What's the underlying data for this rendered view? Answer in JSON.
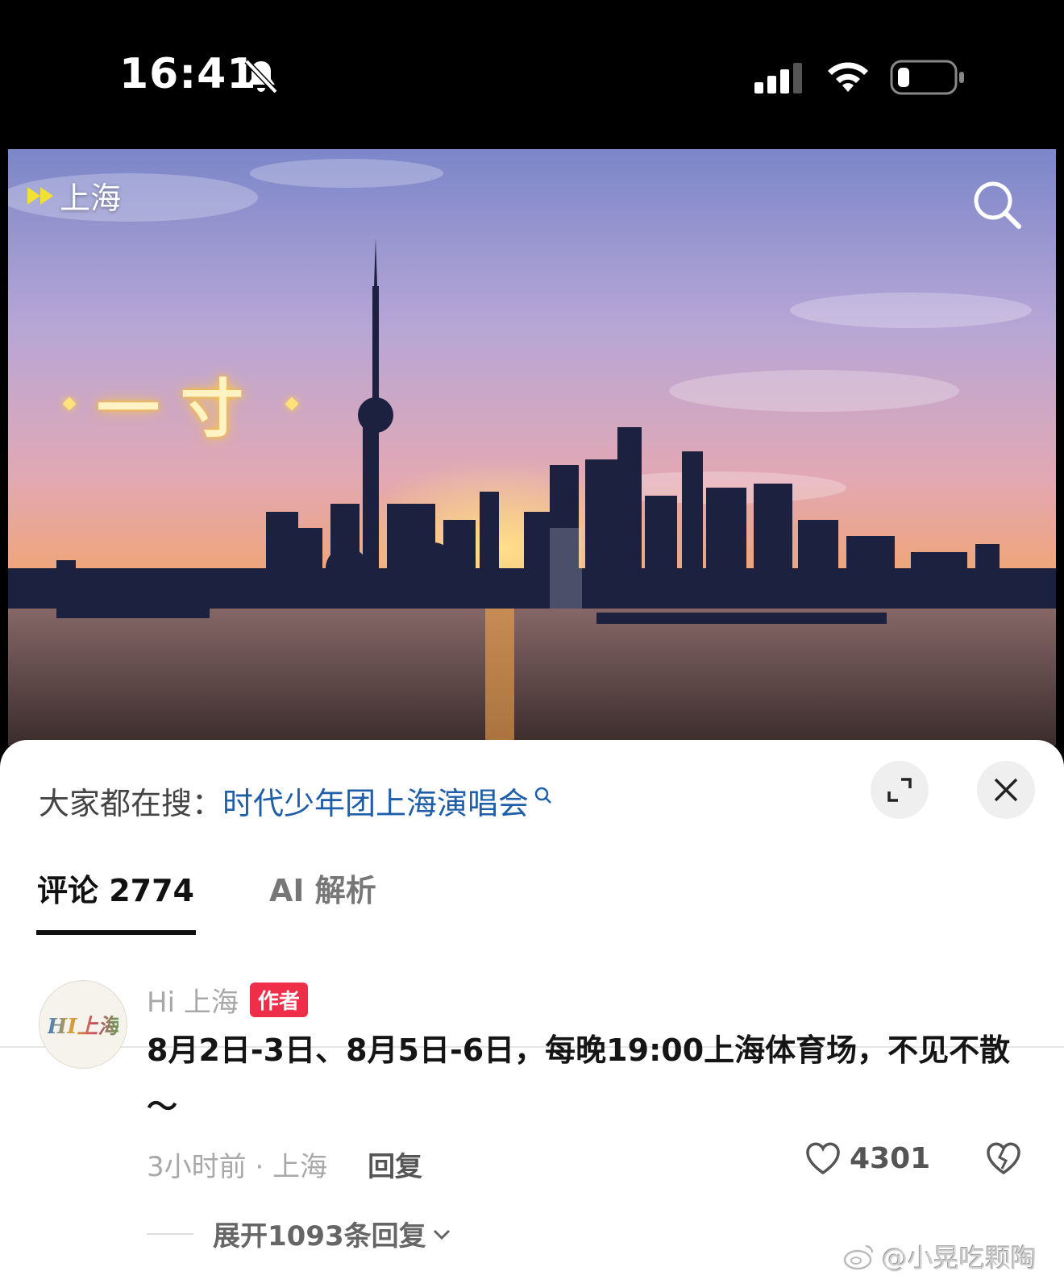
{
  "status_bar": {
    "time": "16:41",
    "icons": [
      "bell-slash-icon",
      "signal-icon",
      "wifi-icon",
      "battery-icon"
    ],
    "battery_level": 0.15
  },
  "video": {
    "channel_label": "上海",
    "channel_icon": "fast-forward-icon",
    "overlay_text": "一寸",
    "search_icon": "search-icon"
  },
  "hot_search": {
    "prefix": "大家都在搜：",
    "term": "时代少年团上海演唱会"
  },
  "tabs": [
    {
      "label": "评论 2774",
      "active": true
    },
    {
      "label": "AI 解析",
      "active": false
    }
  ],
  "comment": {
    "avatar_text": "HI上海",
    "author": "Hi 上海",
    "badge": "作者",
    "text": "8月2日-3日、8月5日-6日，每晚19:00上海体育场，不见不散～",
    "meta": "3小时前 · 上海",
    "reply_label": "回复",
    "likes": "4301",
    "expand_label": "展开1093条回复"
  },
  "watermark": "@小晃吃颗陶",
  "colors": {
    "accent_link": "#1f5ea8",
    "badge_red": "#ef2f4a"
  }
}
